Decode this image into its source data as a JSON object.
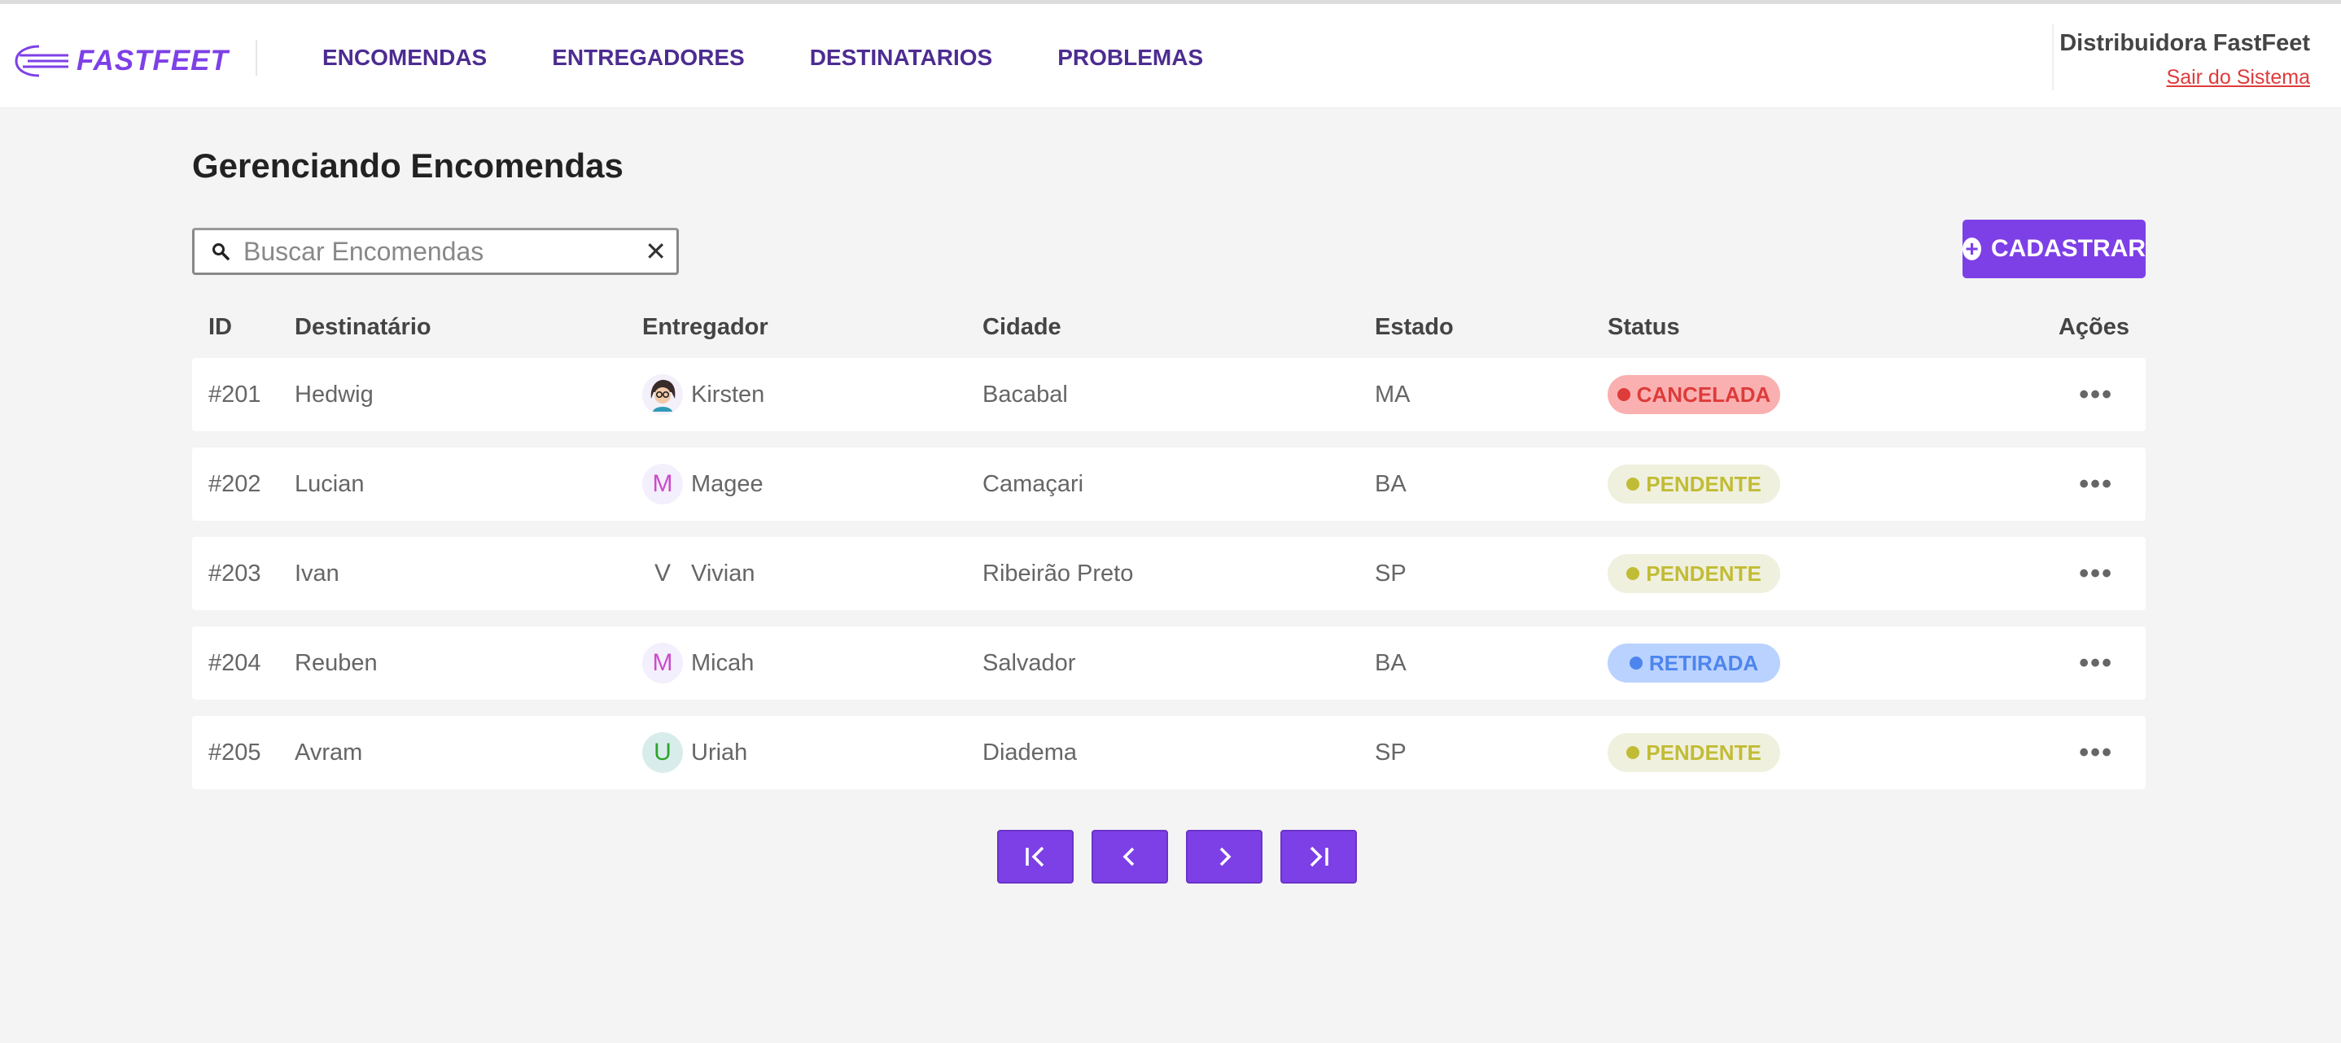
{
  "header": {
    "logo_text": "FASTFEET",
    "nav": [
      {
        "label": "ENCOMENDAS"
      },
      {
        "label": "ENTREGADORES"
      },
      {
        "label": "DESTINATARIOS"
      },
      {
        "label": "PROBLEMAS"
      }
    ],
    "user_name": "Distribuidora FastFeet",
    "logout_label": "Sair do Sistema"
  },
  "page": {
    "title": "Gerenciando Encomendas",
    "search_placeholder": "Buscar Encomendas",
    "add_label": "CADASTRAR"
  },
  "table": {
    "columns": [
      "ID",
      "Destinatário",
      "Entregador",
      "Cidade",
      "Estado",
      "Status",
      "Ações"
    ],
    "rows": [
      {
        "id": "#201",
        "recipient": "Hedwig",
        "deliverer": "Kirsten",
        "avatar": "",
        "avatar_type": "photo",
        "city": "Bacabal",
        "state": "MA",
        "status": "CANCELADA",
        "status_color": "#de3b3b",
        "status_bg": "#fab0b0"
      },
      {
        "id": "#202",
        "recipient": "Lucian",
        "deliverer": "Magee",
        "avatar": "M",
        "avatar_type": "initial",
        "avatar_color": "#cb4ccb",
        "avatar_bg": "#f4effc",
        "city": "Camaçari",
        "state": "BA",
        "status": "PENDENTE",
        "status_color": "#c1bc35",
        "status_bg": "#f0f0df"
      },
      {
        "id": "#203",
        "recipient": "Ivan",
        "deliverer": "Vivian",
        "avatar": "V",
        "avatar_type": "initial",
        "avatar_color": "#666666",
        "avatar_bg": "#ffffff",
        "city": "Ribeirão Preto",
        "state": "SP",
        "status": "PENDENTE",
        "status_color": "#c1bc35",
        "status_bg": "#f0f0df"
      },
      {
        "id": "#204",
        "recipient": "Reuben",
        "deliverer": "Micah",
        "avatar": "M",
        "avatar_type": "initial",
        "avatar_color": "#cb4ccb",
        "avatar_bg": "#f4effc",
        "city": "Salvador",
        "state": "BA",
        "status": "RETIRADA",
        "status_color": "#4d85ee",
        "status_bg": "#bad2ff"
      },
      {
        "id": "#205",
        "recipient": "Avram",
        "deliverer": "Uriah",
        "avatar": "U",
        "avatar_type": "initial",
        "avatar_color": "#2ca42b",
        "avatar_bg": "#d9ecec",
        "city": "Diadema",
        "state": "SP",
        "status": "PENDENTE",
        "status_color": "#c1bc35",
        "status_bg": "#f0f0df"
      }
    ],
    "actions_glyph": "•••"
  },
  "pagination": [
    {
      "name": "first-page-icon"
    },
    {
      "name": "prev-page-icon"
    },
    {
      "name": "next-page-icon"
    },
    {
      "name": "last-page-icon"
    }
  ],
  "colors": {
    "accent": "#7d40e7",
    "nav_text": "#4d2c91",
    "logout": "#de3b3b",
    "background": "#f4f4f4"
  }
}
